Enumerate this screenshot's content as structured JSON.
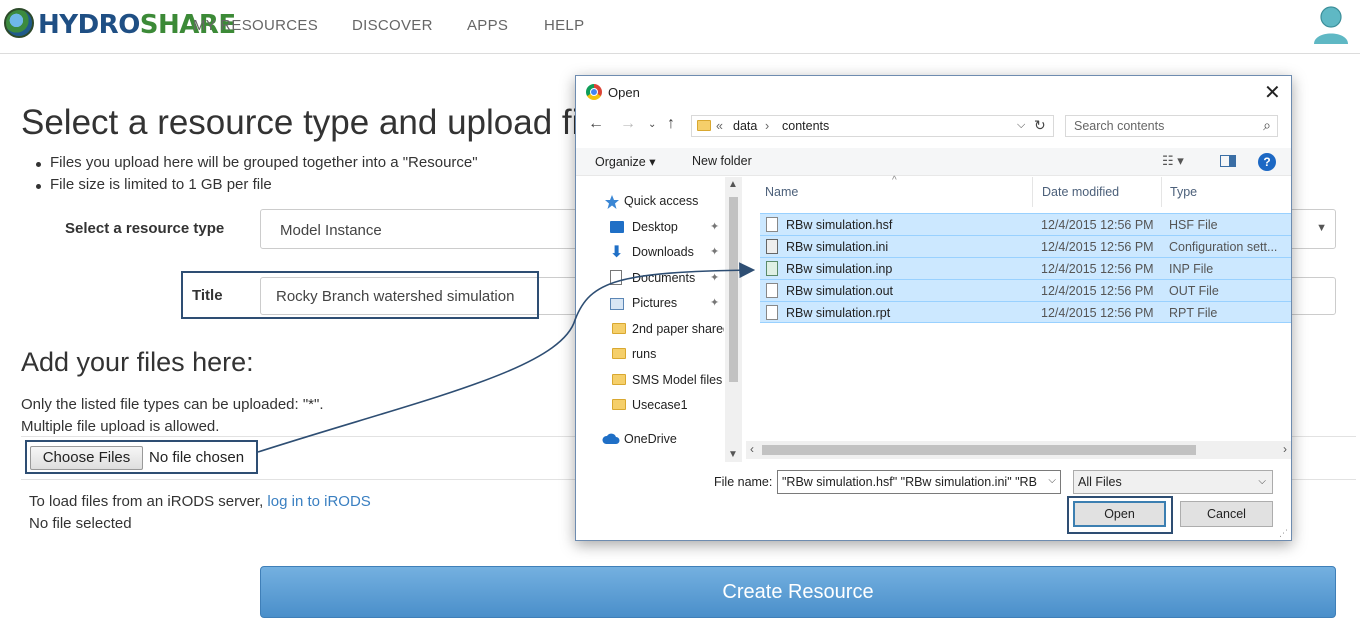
{
  "navbar": {
    "logo_hydro": "HYDRO",
    "logo_share": "SHARE",
    "items": [
      {
        "label": "MY RESOURCES"
      },
      {
        "label": "DISCOVER"
      },
      {
        "label": "APPS"
      },
      {
        "label": "HELP"
      }
    ],
    "user_icon": "user-avatar-icon"
  },
  "page": {
    "title": "Select a resource type and upload files",
    "bullets": [
      "Files you upload here will be grouped together into a \"Resource\"",
      "File size is limited to 1 GB per file"
    ],
    "resource_type_label": "Select a resource type",
    "resource_type_value": "Model Instance",
    "title_label": "Title",
    "title_value": "Rocky Branch watershed simulation",
    "files_heading": "Add your files here:",
    "files_note_1": "Only the listed file types can be uploaded: \"*\".",
    "files_note_2": "Multiple file upload is allowed.",
    "choose_files_label": "Choose Files",
    "no_file_chosen": "No file chosen",
    "irods_text": "To load files from an iRODS server, ",
    "irods_link": "log in to iRODS",
    "no_file_selected": "No file selected",
    "create_button": "Create Resource"
  },
  "dialog": {
    "title": "Open",
    "breadcrumb": {
      "overflow": "«",
      "parts": [
        "data",
        "contents"
      ],
      "separator": "›"
    },
    "search_placeholder": "Search contents",
    "organize_label": "Organize ▾",
    "new_folder_label": "New folder",
    "nav_items": [
      {
        "label": "Quick access",
        "icon": "star-icon"
      },
      {
        "label": "Desktop",
        "icon": "desktop-icon"
      },
      {
        "label": "Downloads",
        "icon": "download-icon"
      },
      {
        "label": "Documents",
        "icon": "document-icon"
      },
      {
        "label": "Pictures",
        "icon": "pictures-icon"
      },
      {
        "label": "2nd paper shared",
        "icon": "folder-icon"
      },
      {
        "label": "runs",
        "icon": "folder-icon"
      },
      {
        "label": "SMS Model files",
        "icon": "folder-icon"
      },
      {
        "label": "Usecase1",
        "icon": "folder-icon"
      },
      {
        "label": "OneDrive",
        "icon": "cloud-icon"
      }
    ],
    "columns": {
      "name": "Name",
      "date": "Date modified",
      "type": "Type"
    },
    "files": [
      {
        "name": "RBw simulation.hsf",
        "date": "12/4/2015 12:56 PM",
        "type": "HSF File"
      },
      {
        "name": "RBw simulation.ini",
        "date": "12/4/2015 12:56 PM",
        "type": "Configuration sett..."
      },
      {
        "name": "RBw simulation.inp",
        "date": "12/4/2015 12:56 PM",
        "type": "INP File"
      },
      {
        "name": "RBw simulation.out",
        "date": "12/4/2015 12:56 PM",
        "type": "OUT File"
      },
      {
        "name": "RBw simulation.rpt",
        "date": "12/4/2015 12:56 PM",
        "type": "RPT File"
      }
    ],
    "file_name_label": "File name:",
    "file_name_value": "\"RBw simulation.hsf\" \"RBw simulation.ini\" \"RB",
    "filter_value": "All Files",
    "open_button": "Open",
    "cancel_button": "Cancel"
  },
  "colors": {
    "accent_blue": "#4a8fca",
    "highlight_outline": "#2e4e73",
    "selection": "#cce8ff",
    "link": "#3a7fc1"
  }
}
